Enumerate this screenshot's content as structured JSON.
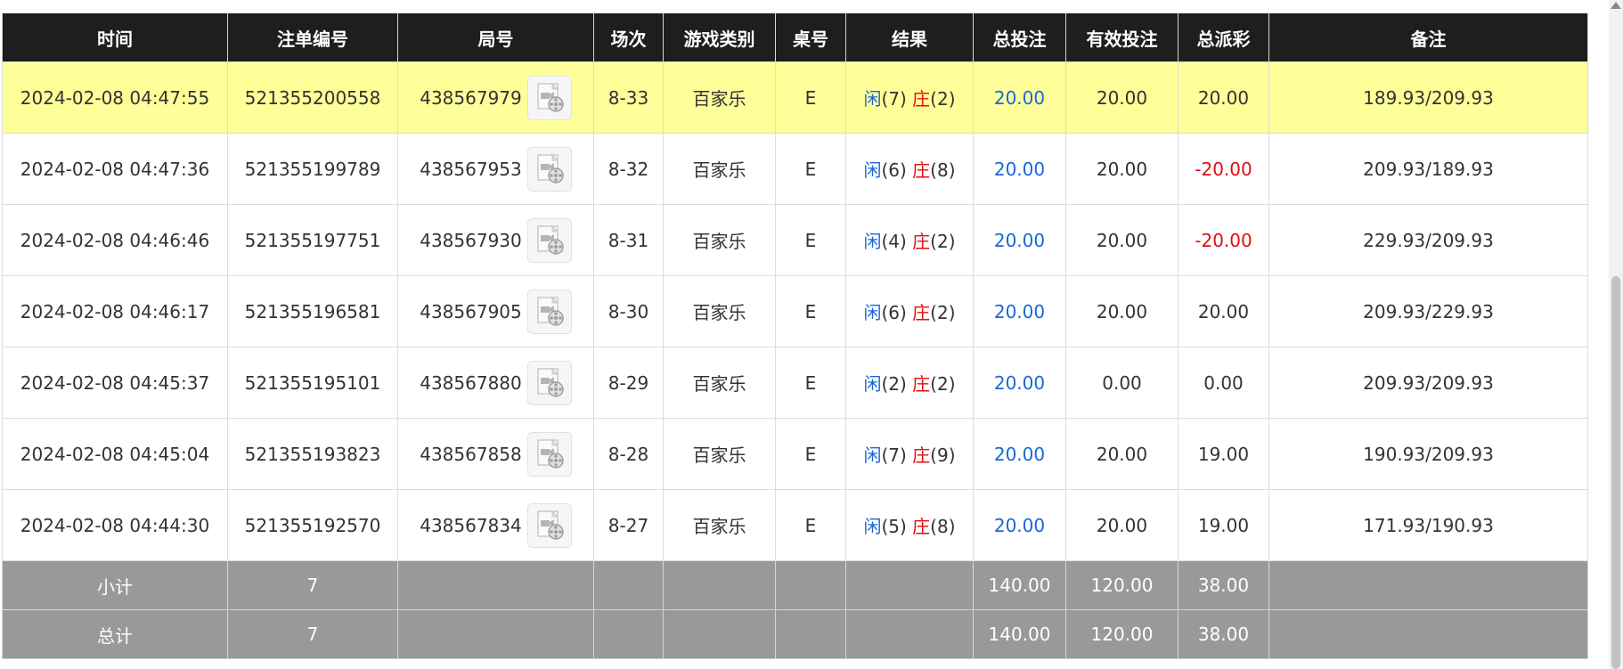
{
  "headers": [
    "时间",
    "注单编号",
    "局号",
    "场次",
    "游戏类别",
    "桌号",
    "结果",
    "总投注",
    "有效投注",
    "总派彩",
    "备注"
  ],
  "rows": [
    {
      "time": "2024-02-08 04:47:55",
      "bet_id": "521355200558",
      "round": "438567979",
      "session": "8-33",
      "game": "百家乐",
      "table": "E",
      "player_label": "闲",
      "player_score": "(7)",
      "banker_label": "庄",
      "banker_score": "(2)",
      "total_bet": "20.00",
      "valid_bet": "20.00",
      "payout": "20.00",
      "payout_negative": false,
      "remark": "189.93/209.93",
      "highlighted": true
    },
    {
      "time": "2024-02-08 04:47:36",
      "bet_id": "521355199789",
      "round": "438567953",
      "session": "8-32",
      "game": "百家乐",
      "table": "E",
      "player_label": "闲",
      "player_score": "(6)",
      "banker_label": "庄",
      "banker_score": "(8)",
      "total_bet": "20.00",
      "valid_bet": "20.00",
      "payout": "-20.00",
      "payout_negative": true,
      "remark": "209.93/189.93",
      "highlighted": false
    },
    {
      "time": "2024-02-08 04:46:46",
      "bet_id": "521355197751",
      "round": "438567930",
      "session": "8-31",
      "game": "百家乐",
      "table": "E",
      "player_label": "闲",
      "player_score": "(4)",
      "banker_label": "庄",
      "banker_score": "(2)",
      "total_bet": "20.00",
      "valid_bet": "20.00",
      "payout": "-20.00",
      "payout_negative": true,
      "remark": "229.93/209.93",
      "highlighted": false
    },
    {
      "time": "2024-02-08 04:46:17",
      "bet_id": "521355196581",
      "round": "438567905",
      "session": "8-30",
      "game": "百家乐",
      "table": "E",
      "player_label": "闲",
      "player_score": "(6)",
      "banker_label": "庄",
      "banker_score": "(2)",
      "total_bet": "20.00",
      "valid_bet": "20.00",
      "payout": "20.00",
      "payout_negative": false,
      "remark": "209.93/229.93",
      "highlighted": false
    },
    {
      "time": "2024-02-08 04:45:37",
      "bet_id": "521355195101",
      "round": "438567880",
      "session": "8-29",
      "game": "百家乐",
      "table": "E",
      "player_label": "闲",
      "player_score": "(2)",
      "banker_label": "庄",
      "banker_score": "(2)",
      "total_bet": "20.00",
      "valid_bet": "0.00",
      "payout": "0.00",
      "payout_negative": false,
      "remark": "209.93/209.93",
      "highlighted": false
    },
    {
      "time": "2024-02-08 04:45:04",
      "bet_id": "521355193823",
      "round": "438567858",
      "session": "8-28",
      "game": "百家乐",
      "table": "E",
      "player_label": "闲",
      "player_score": "(7)",
      "banker_label": "庄",
      "banker_score": "(9)",
      "total_bet": "20.00",
      "valid_bet": "20.00",
      "payout": "19.00",
      "payout_negative": false,
      "remark": "190.93/209.93",
      "highlighted": false
    },
    {
      "time": "2024-02-08 04:44:30",
      "bet_id": "521355192570",
      "round": "438567834",
      "session": "8-27",
      "game": "百家乐",
      "table": "E",
      "player_label": "闲",
      "player_score": "(5)",
      "banker_label": "庄",
      "banker_score": "(8)",
      "total_bet": "20.00",
      "valid_bet": "20.00",
      "payout": "19.00",
      "payout_negative": false,
      "remark": "171.93/190.93",
      "highlighted": false
    }
  ],
  "summary": [
    {
      "label": "小计",
      "count": "7",
      "total_bet": "140.00",
      "valid_bet": "120.00",
      "payout": "38.00"
    },
    {
      "label": "总计",
      "count": "7",
      "total_bet": "140.00",
      "valid_bet": "120.00",
      "payout": "38.00"
    }
  ],
  "colors": {
    "header_bg": "#1e1e1e",
    "highlight_row": "#ffff99",
    "summary_bg": "#999999",
    "player_blue": "#1a66d9",
    "banker_red": "#e10e0e",
    "negative_red": "#e10e0e"
  },
  "icons": {
    "video": "video-replay-icon"
  }
}
